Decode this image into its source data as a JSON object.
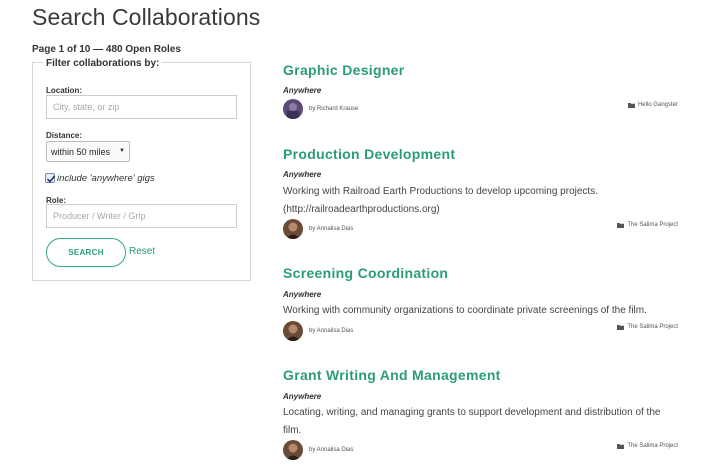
{
  "page": {
    "title": "Search Collaborations",
    "count": "Page 1 of 10 — 480 Open Roles"
  },
  "filter": {
    "legend": "Filter collaborations by:",
    "location_label": "Location:",
    "location_placeholder": "City, state, or zip",
    "location_value": "",
    "distance_label": "Distance:",
    "distance_value": "within 50 miles",
    "include_anywhere_label": "include 'anywhere' gigs",
    "include_anywhere_checked": true,
    "role_label": "Role:",
    "role_placeholder": "Producer / Writer / Grip",
    "role_value": "",
    "search_label": "SEARCH",
    "reset_label": "Reset"
  },
  "colors": {
    "accent": "#2a9c78"
  },
  "results": [
    {
      "title": "Graphic Designer",
      "location": "Anywhere",
      "description": "",
      "by": "by Richard Krause",
      "project": "Hello Gangster",
      "icon": "folder-icon"
    },
    {
      "title": "Production Development",
      "location": "Anywhere",
      "description": "Working with Railroad Earth Productions to develop upcoming projects. (http://railroadearthproductions.org)",
      "by": "by Annalisa Dias",
      "project": "The Salima Project",
      "icon": "folder-icon"
    },
    {
      "title": "Screening Coordination",
      "location": "Anywhere",
      "description": "Working with community organizations to coordinate private screenings of the film.",
      "by": "by Annalisa Dias",
      "project": "The Salima Project",
      "icon": "folder-icon"
    },
    {
      "title": "Grant Writing And Management",
      "location": "Anywhere",
      "description": "Locating, writing, and managing grants to support development and distribution of the film.",
      "by": "by Annalisa Dias",
      "project": "The Salima Project",
      "icon": "folder-icon"
    }
  ]
}
